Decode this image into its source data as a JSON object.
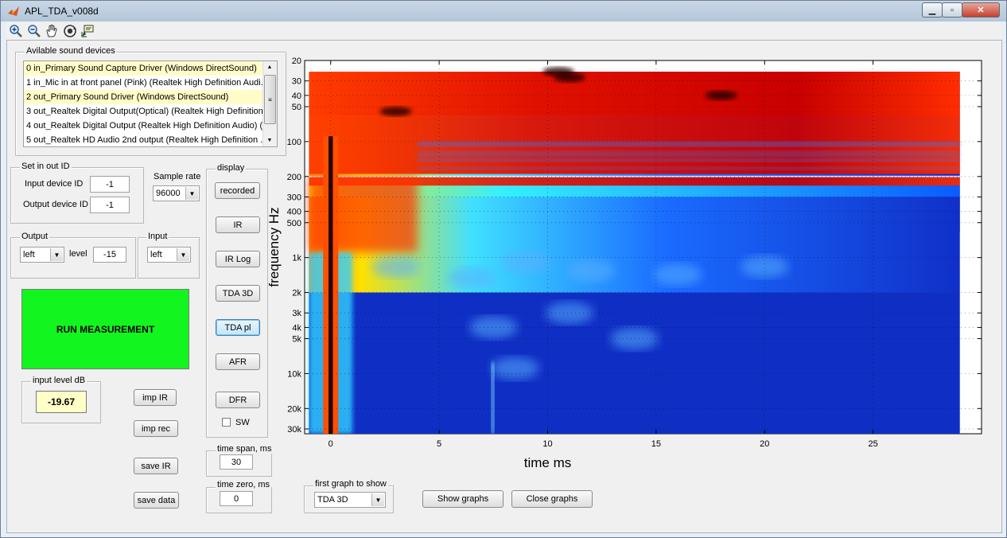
{
  "window": {
    "title": "APL_TDA_v008d"
  },
  "devices": {
    "label": "Avilable sound devices",
    "items": [
      "0 in_Primary Sound Capture Driver (Windows DirectSound)",
      "1 in_Mic in at front panel (Pink) (Realtek High Definition Audi...",
      "2 out_Primary Sound Driver (Windows DirectSound)",
      "3 out_Realtek Digital Output(Optical) (Realtek High Definition ...",
      "4 out_Realtek Digital Output (Realtek High Definition Audio) (...",
      "5 out_Realtek HD Audio 2nd output (Realtek High Definition ..."
    ]
  },
  "io_id": {
    "label": "Set in out ID",
    "input_label": "Input device ID",
    "input_value": "-1",
    "output_label": "Output device ID",
    "output_value": "-1"
  },
  "sample_rate": {
    "label": "Sample rate",
    "value": "96000"
  },
  "output": {
    "label": "Output",
    "channel": "left",
    "level_label": "level",
    "level_value": "-15"
  },
  "input": {
    "label": "Input",
    "channel": "left"
  },
  "run_label": "RUN MEASUREMENT",
  "input_level": {
    "label": "input level dB",
    "value": "-19.67"
  },
  "buttons": {
    "imp_ir": "imp IR",
    "imp_rec": "imp rec",
    "save_ir": "save IR",
    "save_data": "save data",
    "show_graphs": "Show graphs",
    "close_graphs": "Close graphs"
  },
  "display": {
    "label": "display",
    "recorded": "recorded",
    "ir": "IR",
    "ir_log": "IR Log",
    "tda3d": "TDA 3D",
    "tdapl": "TDA pl",
    "afr": "AFR",
    "dfr": "DFR",
    "sw": "SW"
  },
  "time_span": {
    "label": "time span, ms",
    "value": "30"
  },
  "time_zero": {
    "label": "time zero, ms",
    "value": "0"
  },
  "first_graph": {
    "label": "first graph to show",
    "value": "TDA 3D"
  },
  "chart_data": {
    "type": "heatmap",
    "xlabel": "time   ms",
    "ylabel": "frequency   Hz",
    "x_ticks": [
      0,
      5,
      10,
      15,
      20,
      25
    ],
    "xlim": [
      -1.2,
      30
    ],
    "y_scale": "log",
    "ylim": [
      20,
      33000
    ],
    "y_ticks": [
      {
        "value": 20,
        "label": "20"
      },
      {
        "value": 30,
        "label": "30"
      },
      {
        "value": 40,
        "label": "40"
      },
      {
        "value": 50,
        "label": "50"
      },
      {
        "value": 100,
        "label": "100"
      },
      {
        "value": 200,
        "label": "200"
      },
      {
        "value": 300,
        "label": "300"
      },
      {
        "value": 400,
        "label": "400"
      },
      {
        "value": 500,
        "label": "500"
      },
      {
        "value": 1000,
        "label": "1k"
      },
      {
        "value": 2000,
        "label": "2k"
      },
      {
        "value": 3000,
        "label": "3k"
      },
      {
        "value": 4000,
        "label": "4k"
      },
      {
        "value": 5000,
        "label": "5k"
      },
      {
        "value": 10000,
        "label": "10k"
      },
      {
        "value": 20000,
        "label": "20k"
      },
      {
        "value": 30000,
        "label": "30k"
      }
    ],
    "colormap": "jet",
    "data_extent": {
      "time": [
        -1,
        29
      ],
      "frequency": [
        25,
        33000
      ]
    }
  },
  "colors": {
    "run_button": "#13f51e",
    "level_box": "#ffffc8",
    "list_selected": "#fffcc8"
  }
}
